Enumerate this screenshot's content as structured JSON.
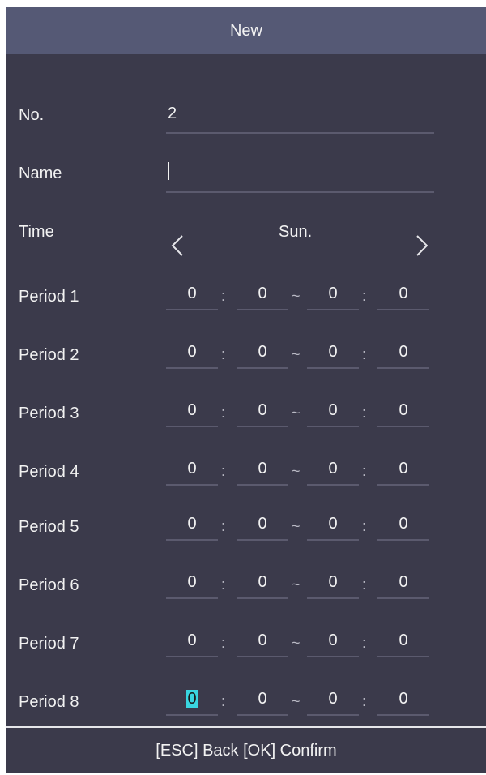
{
  "header": {
    "title": "New"
  },
  "form": {
    "no": {
      "label": "No.",
      "value": "2"
    },
    "name": {
      "label": "Name",
      "value": ""
    },
    "time": {
      "label": "Time",
      "day": "Sun."
    }
  },
  "periods": [
    {
      "label": "Period 1",
      "start_h": "0",
      "start_m": "0",
      "end_h": "0",
      "end_m": "0"
    },
    {
      "label": "Period 2",
      "start_h": "0",
      "start_m": "0",
      "end_h": "0",
      "end_m": "0"
    },
    {
      "label": "Period 3",
      "start_h": "0",
      "start_m": "0",
      "end_h": "0",
      "end_m": "0"
    },
    {
      "label": "Period 4",
      "start_h": "0",
      "start_m": "0",
      "end_h": "0",
      "end_m": "0"
    },
    {
      "label": "Period 5",
      "start_h": "0",
      "start_m": "0",
      "end_h": "0",
      "end_m": "0"
    },
    {
      "label": "Period 6",
      "start_h": "0",
      "start_m": "0",
      "end_h": "0",
      "end_m": "0"
    },
    {
      "label": "Period 7",
      "start_h": "0",
      "start_m": "0",
      "end_h": "0",
      "end_m": "0"
    },
    {
      "label": "Period 8",
      "start_h": "0",
      "start_m": "0",
      "end_h": "0",
      "end_m": "0"
    }
  ],
  "separators": {
    "colon": ":",
    "range": "~"
  },
  "icons": {
    "prev": "chevron-left-icon",
    "next": "chevron-right-icon"
  },
  "colors": {
    "background": "#3b3a4b",
    "header": "#555975",
    "focus_highlight": "#39d6e0"
  },
  "footer": {
    "hint": "[ESC] Back [OK] Confirm"
  }
}
